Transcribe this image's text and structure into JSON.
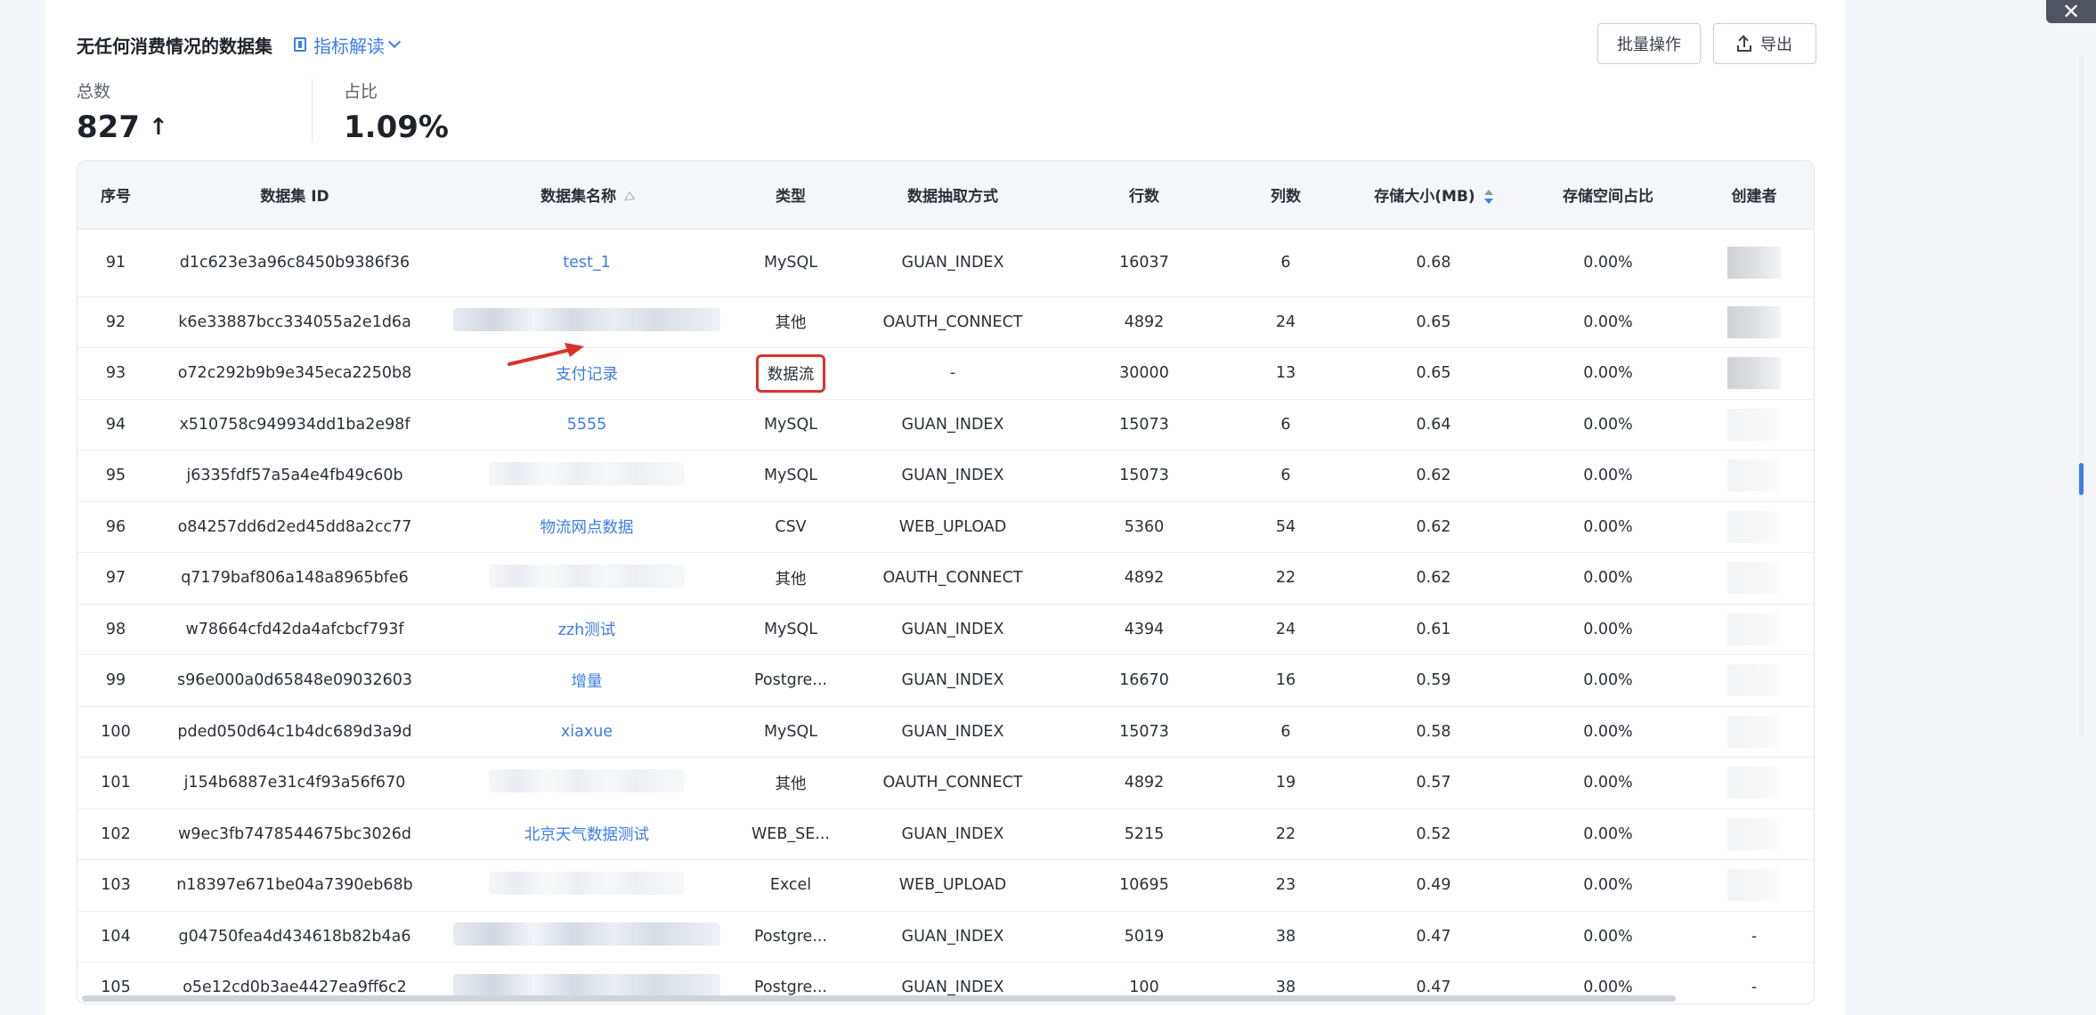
{
  "header": {
    "title": "无任何消费情况的数据集",
    "metric_link": "指标解读",
    "batch_button": "批量操作",
    "export_button": "导出"
  },
  "stats": [
    {
      "label": "总数",
      "value": "827",
      "trend": "↑"
    },
    {
      "label": "占比",
      "value": "1.09%"
    }
  ],
  "table": {
    "columns": [
      "序号",
      "数据集 ID",
      "数据集名称",
      "类型",
      "数据抽取方式",
      "行数",
      "列数",
      "存储大小(MB)",
      "存储空间占比",
      "创建者"
    ],
    "rows": [
      {
        "no": "91",
        "id": "d1c623e3a96c8450b9386f36",
        "name": "test_1",
        "type": "MySQL",
        "method": "GUAN_INDEX",
        "rows": "16037",
        "cols": "6",
        "size": "0.68",
        "ratio": "0.00%",
        "creator": ""
      },
      {
        "no": "92",
        "id": "k6e33887bcc334055a2e1d6a",
        "name": "",
        "type": "其他",
        "method": "OAUTH_CONNECT",
        "rows": "4892",
        "cols": "24",
        "size": "0.65",
        "ratio": "0.00%",
        "creator": ""
      },
      {
        "no": "93",
        "id": "o72c292b9b9e345eca2250b8",
        "name": "支付记录",
        "type": "数据流",
        "method": "-",
        "rows": "30000",
        "cols": "13",
        "size": "0.65",
        "ratio": "0.00%",
        "creator": ""
      },
      {
        "no": "94",
        "id": "x510758c949934dd1ba2e98f",
        "name": "5555",
        "type": "MySQL",
        "method": "GUAN_INDEX",
        "rows": "15073",
        "cols": "6",
        "size": "0.64",
        "ratio": "0.00%",
        "creator": ""
      },
      {
        "no": "95",
        "id": "j6335fdf57a5a4e4fb49c60b",
        "name": "",
        "type": "MySQL",
        "method": "GUAN_INDEX",
        "rows": "15073",
        "cols": "6",
        "size": "0.62",
        "ratio": "0.00%",
        "creator": ""
      },
      {
        "no": "96",
        "id": "o84257dd6d2ed45dd8a2cc77",
        "name": "物流网点数据",
        "type": "CSV",
        "method": "WEB_UPLOAD",
        "rows": "5360",
        "cols": "54",
        "size": "0.62",
        "ratio": "0.00%",
        "creator": ""
      },
      {
        "no": "97",
        "id": "q7179baf806a148a8965bfe6",
        "name": "",
        "type": "其他",
        "method": "OAUTH_CONNECT",
        "rows": "4892",
        "cols": "22",
        "size": "0.62",
        "ratio": "0.00%",
        "creator": ""
      },
      {
        "no": "98",
        "id": "w78664cfd42da4afcbcf793f",
        "name": "zzh测试",
        "type": "MySQL",
        "method": "GUAN_INDEX",
        "rows": "4394",
        "cols": "24",
        "size": "0.61",
        "ratio": "0.00%",
        "creator": ""
      },
      {
        "no": "99",
        "id": "s96e000a0d65848e09032603",
        "name": "增量",
        "type": "Postgre...",
        "method": "GUAN_INDEX",
        "rows": "16670",
        "cols": "16",
        "size": "0.59",
        "ratio": "0.00%",
        "creator": ""
      },
      {
        "no": "100",
        "id": "pded050d64c1b4dc689d3a9d",
        "name": "xiaxue",
        "type": "MySQL",
        "method": "GUAN_INDEX",
        "rows": "15073",
        "cols": "6",
        "size": "0.58",
        "ratio": "0.00%",
        "creator": ""
      },
      {
        "no": "101",
        "id": "j154b6887e31c4f93a56f670",
        "name": "",
        "type": "其他",
        "method": "OAUTH_CONNECT",
        "rows": "4892",
        "cols": "19",
        "size": "0.57",
        "ratio": "0.00%",
        "creator": ""
      },
      {
        "no": "102",
        "id": "w9ec3fb7478544675bc3026d",
        "name": "北京天气数据测试",
        "type": "WEB_SE...",
        "method": "GUAN_INDEX",
        "rows": "5215",
        "cols": "22",
        "size": "0.52",
        "ratio": "0.00%",
        "creator": ""
      },
      {
        "no": "103",
        "id": "n18397e671be04a7390eb68b",
        "name": "",
        "type": "Excel",
        "method": "WEB_UPLOAD",
        "rows": "10695",
        "cols": "23",
        "size": "0.49",
        "ratio": "0.00%",
        "creator": ""
      },
      {
        "no": "104",
        "id": "g04750fea4d434618b82b4a6",
        "name": "",
        "type": "Postgre...",
        "method": "GUAN_INDEX",
        "rows": "5019",
        "cols": "38",
        "size": "0.47",
        "ratio": "0.00%",
        "creator": "-"
      },
      {
        "no": "105",
        "id": "o5e12cd0b3ae4427ea9ff6c2",
        "name": "",
        "type": "Postgre...",
        "method": "GUAN_INDEX",
        "rows": "100",
        "cols": "38",
        "size": "0.47",
        "ratio": "0.00%",
        "creator": "-"
      }
    ]
  },
  "colors": {
    "accent": "#3d7de8",
    "highlight": "#d9332b"
  }
}
